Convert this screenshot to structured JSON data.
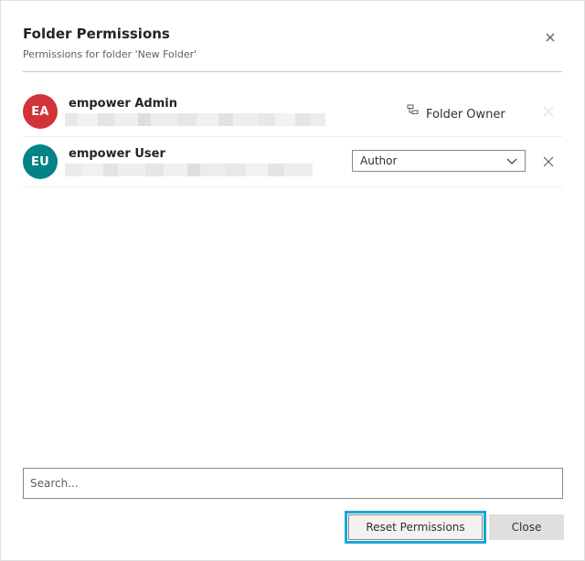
{
  "dialog": {
    "title": "Folder Permissions",
    "subtitle": "Permissions for folder 'New Folder'"
  },
  "users": [
    {
      "initials": "EA",
      "name": "empower Admin",
      "avatar_color": "#d13438",
      "role_label": "Folder Owner"
    },
    {
      "initials": "EU",
      "name": "empower User",
      "avatar_color": "#038387",
      "role_value": "Author"
    }
  ],
  "search": {
    "placeholder": "Search..."
  },
  "buttons": {
    "reset_label": "Reset Permissions",
    "close_label": "Close"
  },
  "colors": {
    "focus_ring": "#1aa7d6",
    "divider": "#c8c6c4"
  }
}
